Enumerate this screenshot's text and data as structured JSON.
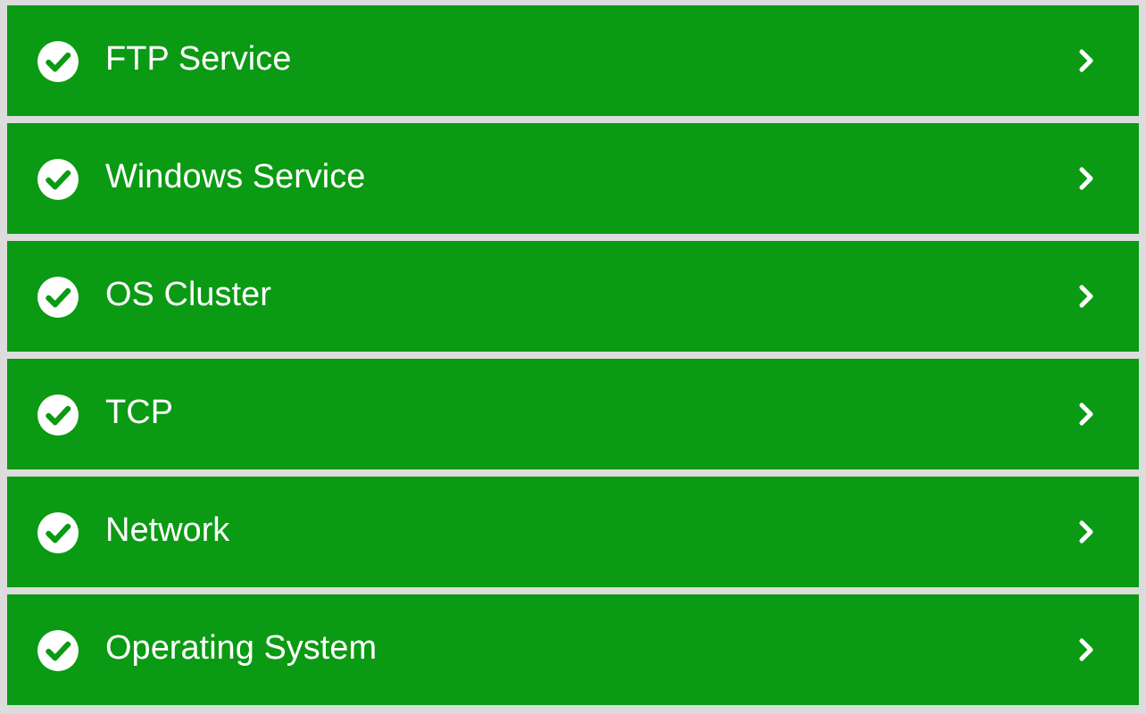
{
  "services": [
    {
      "name": "FTP Service",
      "ok": true
    },
    {
      "name": "Windows Service",
      "ok": true
    },
    {
      "name": "OS Cluster",
      "ok": true
    },
    {
      "name": "TCP",
      "ok": true
    },
    {
      "name": "Network",
      "ok": true
    },
    {
      "name": "Operating System",
      "ok": true
    }
  ]
}
